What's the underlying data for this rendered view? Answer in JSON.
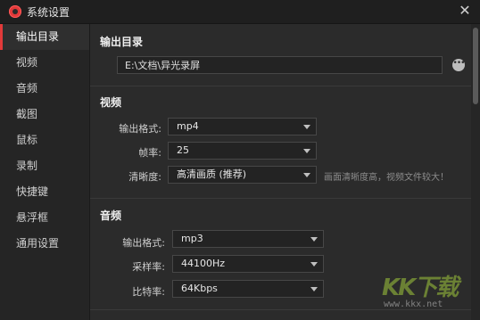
{
  "window": {
    "title": "系统设置",
    "close_glyph": "✕"
  },
  "sidebar": {
    "items": [
      {
        "label": "输出目录",
        "active": true
      },
      {
        "label": "视频"
      },
      {
        "label": "音频"
      },
      {
        "label": "截图"
      },
      {
        "label": "鼠标"
      },
      {
        "label": "录制"
      },
      {
        "label": "快捷键"
      },
      {
        "label": "悬浮框"
      },
      {
        "label": "通用设置"
      }
    ]
  },
  "output_dir": {
    "title": "输出目录",
    "path": "E:\\文档\\异光录屏",
    "more_glyph": "•••"
  },
  "video": {
    "title": "视频",
    "format_label": "输出格式:",
    "format_value": "mp4",
    "fps_label": "帧率:",
    "fps_value": "25",
    "quality_label": "清晰度:",
    "quality_value": "高清画质 (推荐)",
    "quality_hint": "画面清晰度高，视频文件较大！"
  },
  "audio": {
    "title": "音频",
    "format_label": "输出格式:",
    "format_value": "mp3",
    "sample_label": "采样率:",
    "sample_value": "44100Hz",
    "bitrate_label": "比特率:",
    "bitrate_value": "64Kbps"
  },
  "watermark": {
    "logo": "KK下载",
    "url": "www.kkx.net"
  },
  "colors": {
    "accent": "#e23a3a",
    "background": "#2b2b2b",
    "sidebar": "#252525"
  }
}
